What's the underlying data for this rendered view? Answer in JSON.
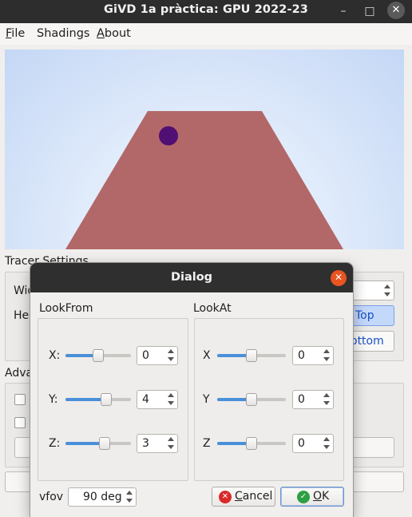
{
  "window": {
    "title": "GiVD 1a pràctica: GPU 2022-23"
  },
  "menu": {
    "file": {
      "accel": "F",
      "rest": "ile"
    },
    "shadings": {
      "accel": "",
      "rest": "Shadings"
    },
    "about": {
      "accel": "A",
      "rest": "bout"
    }
  },
  "background": {
    "tracer_settings": "Tracer Settings",
    "width_label": "Wid",
    "height_label": "He",
    "top_button": "Top",
    "bottom_button": "ottom",
    "advanced_label": "Adva"
  },
  "dialog": {
    "title": "Dialog",
    "lookfrom": {
      "title": "LookFrom",
      "rows": [
        {
          "label": "X:",
          "value": "0",
          "slider_fraction": 0.5
        },
        {
          "label": "Y:",
          "value": "4",
          "slider_fraction": 0.65
        },
        {
          "label": "Z:",
          "value": "3",
          "slider_fraction": 0.62
        }
      ]
    },
    "lookat": {
      "title": "LookAt",
      "rows": [
        {
          "label": "X",
          "value": "0",
          "slider_fraction": 0.5
        },
        {
          "label": "Y",
          "value": "0",
          "slider_fraction": 0.5
        },
        {
          "label": "Z",
          "value": "0",
          "slider_fraction": 0.5
        }
      ]
    },
    "vfov": {
      "label": "vfov",
      "value": "90 deg"
    },
    "cancel": {
      "accel": "C",
      "rest": "ancel"
    },
    "ok": {
      "accel": "O",
      "rest": "K"
    }
  },
  "colors": {
    "floor": "#b26868",
    "sphere": "#4f0f73",
    "close_button": "#e95420",
    "slider_fill": "#4a8fd9",
    "cancel_icon": "#d92a2a",
    "ok_icon": "#2ea043"
  }
}
